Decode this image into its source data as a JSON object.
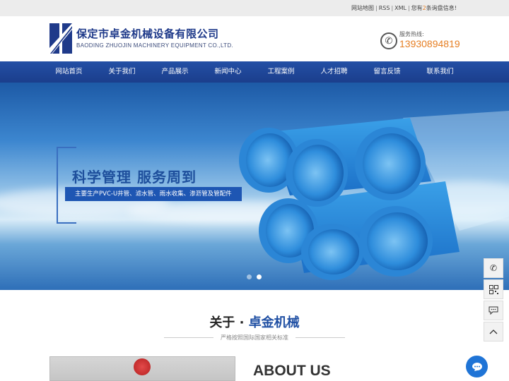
{
  "topbar": {
    "sitemap": "网站地图",
    "rss": "RSS",
    "xml": "XML",
    "msg_prefix": "您有",
    "msg_count": "2",
    "msg_suffix": "条询盘信息!"
  },
  "header": {
    "company_cn": "保定市卓金机械设备有限公司",
    "company_en": "BAODING ZHUOJIN MACHINERY EQUIPMENT CO.,LTD.",
    "hotline_label": "服务热线:",
    "hotline_number": "13930894819"
  },
  "nav": {
    "items": [
      {
        "label": "网站首页"
      },
      {
        "label": "关于我们"
      },
      {
        "label": "产品展示"
      },
      {
        "label": "新闻中心"
      },
      {
        "label": "工程案例"
      },
      {
        "label": "人才招聘"
      },
      {
        "label": "留言反馈"
      },
      {
        "label": "联系我们"
      }
    ]
  },
  "banner": {
    "slogan": "科学管理  服务周到",
    "tagline": "主要生产PVC-U井管、滤水管、雨水收集、渗沥管及管配件",
    "slides": 2,
    "active_slide": 2
  },
  "side_tools": [
    "phone-icon",
    "qrcode-icon",
    "chat-icon",
    "back-to-top-icon"
  ],
  "about": {
    "title_prefix": "关于 · ",
    "title_highlight": "卓金机械",
    "subtitle": "严格按照国际国家相关标准",
    "heading_en": "ABOUT US"
  },
  "colors": {
    "brand_blue": "#1f4fa3",
    "nav_blue": "#234fa5",
    "accent_orange": "#e67e22"
  }
}
